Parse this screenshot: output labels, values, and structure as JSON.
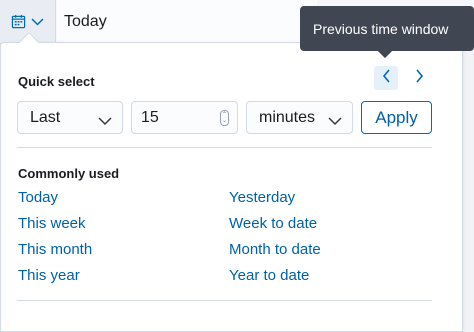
{
  "date_picker": {
    "calendar_icon": "calendar-icon",
    "dropdown_icon": "chevron-down-icon",
    "value": "Today"
  },
  "tooltip": {
    "text": "Previous time window"
  },
  "quick_select": {
    "title": "Quick select",
    "prev_icon": "chevron-left-icon",
    "next_icon": "chevron-right-icon",
    "direction_select": "Last",
    "amount": "15",
    "unit_select": "minutes",
    "apply_label": "Apply"
  },
  "commonly_used": {
    "title": "Commonly used",
    "left": [
      "Today",
      "This week",
      "This month",
      "This year"
    ],
    "right": [
      "Yesterday",
      "Week to date",
      "Month to date",
      "Year to date"
    ]
  },
  "colors": {
    "link": "#0061a6",
    "tooltip_bg": "#404652",
    "button_border": "#006bb8"
  }
}
